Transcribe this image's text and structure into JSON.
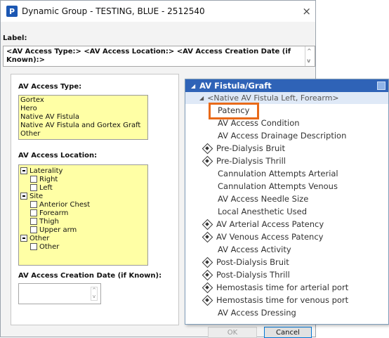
{
  "window": {
    "icon_letter": "P",
    "title": "Dynamic Group - TESTING, BLUE - 2512540",
    "close_glyph": "×"
  },
  "label_field": {
    "caption": "Label:",
    "value": "<AV Access Type:> <AV Access Location:> <AV Access Creation Date (if Known):>",
    "scroll_up": "^",
    "scroll_down": "v"
  },
  "access_type": {
    "title": "AV Access Type:",
    "options": [
      "Gortex",
      "Hero",
      "Native AV Fistula",
      "Native AV Fistula and Gortex Graft",
      "Other"
    ]
  },
  "access_location": {
    "title": "AV Access Location:",
    "tree": [
      {
        "label": "Laterality",
        "kind": "group"
      },
      {
        "label": "Right",
        "kind": "child"
      },
      {
        "label": "Left",
        "kind": "child"
      },
      {
        "label": "Site",
        "kind": "group"
      },
      {
        "label": "Anterior Chest",
        "kind": "child"
      },
      {
        "label": "Forearm",
        "kind": "child"
      },
      {
        "label": "Thigh",
        "kind": "child"
      },
      {
        "label": "Upper arm",
        "kind": "child"
      },
      {
        "label": "Other",
        "kind": "group"
      },
      {
        "label": "Other",
        "kind": "child"
      }
    ]
  },
  "creation_date": {
    "title": "AV Access Creation Date (if Known):",
    "value": "",
    "spin_up": "^",
    "spin_down": "v"
  },
  "popup": {
    "header": "AV Fistula/Graft",
    "header_arrow": "◢",
    "sub_header": "<Native AV Fistula Left, Forearm>",
    "sub_arrow": "◢",
    "items": [
      {
        "label": "Patency",
        "icon": "none",
        "highlighted": true
      },
      {
        "label": "AV Access Condition",
        "icon": "none"
      },
      {
        "label": "AV Access Drainage Description",
        "icon": "none"
      },
      {
        "label": "Pre-Dialysis Bruit",
        "icon": "diamond-icon"
      },
      {
        "label": "Pre-Dialysis Thrill",
        "icon": "diamond-icon"
      },
      {
        "label": "Cannulation Attempts Arterial",
        "icon": "none"
      },
      {
        "label": "Cannulation Attempts Venous",
        "icon": "none"
      },
      {
        "label": "AV Access Needle Size",
        "icon": "none"
      },
      {
        "label": "Local Anesthetic Used",
        "icon": "none"
      },
      {
        "label": "AV Arterial Access Patency",
        "icon": "diamond-icon"
      },
      {
        "label": "AV Venous Access Patency",
        "icon": "diamond-icon"
      },
      {
        "label": "AV Access Activity",
        "icon": "none"
      },
      {
        "label": "Post-Dialysis Bruit",
        "icon": "diamond-icon"
      },
      {
        "label": "Post-Dialysis Thrill",
        "icon": "diamond-icon"
      },
      {
        "label": "Hemostasis time for arterial port",
        "icon": "diamond-icon"
      },
      {
        "label": "Hemostasis time for venous port",
        "icon": "diamond-icon"
      },
      {
        "label": "AV Access Dressing",
        "icon": "none"
      }
    ]
  },
  "buttons": {
    "ok": "OK",
    "cancel": "Cancel"
  },
  "colors": {
    "highlight_border": "#e86a1a",
    "popup_header_bg": "#2f63b7",
    "list_bg": "#ffffa5"
  }
}
